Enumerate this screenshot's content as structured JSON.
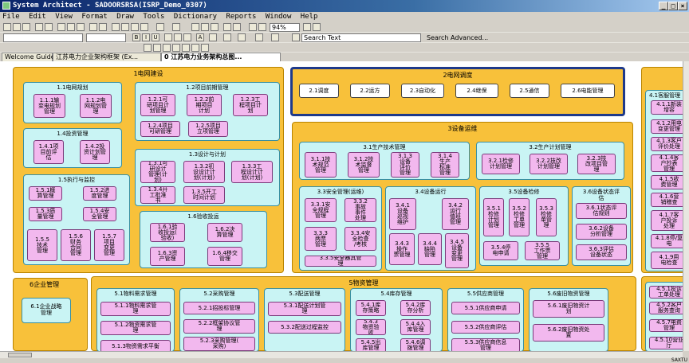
{
  "window": {
    "title": "System Architect - SADOORSRSA(ISRP_Demo_0307)",
    "min": "_",
    "max": "□",
    "close": "×"
  },
  "menu": [
    "File",
    "Edit",
    "View",
    "Format",
    "Draw",
    "Tools",
    "Dictionary",
    "Reports",
    "Window",
    "Help"
  ],
  "toolbar": {
    "zoom": "94%",
    "search_text": "Search Text",
    "search_advanced": "Search Advanced..."
  },
  "tabs": [
    "Welcome Guide",
    "江苏电力企业架构框架 (Ex...",
    "0 江苏电力业务架构总图..."
  ],
  "groups": {
    "g1": {
      "title": "1电网建设",
      "s11": {
        "title": "1.1电网规划",
        "items": [
          "1.1.1输\n变电规划\n管理",
          "1.1.2电\n网规划管\n理"
        ]
      },
      "s12": {
        "title": "1.2项目前期管理",
        "items": [
          "1.2.1可\n研项目计\n划管理",
          "1.2.2前\n期项目\n计划",
          "1.2.3工\n程项目计\n划",
          "1.2.4项目\n可研管理",
          "1.2.5项目\n立项管理"
        ]
      },
      "s14": {
        "title": "1.4投资管理",
        "items": [
          "1.4.1项\n目前评\n估",
          "1.4.2投\n资计划管\n理"
        ]
      },
      "s13": {
        "title": "1.3设计与计划",
        "items": [
          "1.3.1可\n研设计\n管理(计\n划)",
          "1.3.2初\n设设计计\n划(计划)",
          "1.3.3工\n程设计计\n划(计划)",
          "1.3.4开\n工批准\n书",
          "1.3.5开工\n时间计划"
        ]
      },
      "s15": {
        "title": "1.5执行与监控",
        "items": [
          "1.5.1概\n算管理",
          "1.5.2进\n度管理",
          "1.5.3质\n量管理",
          "1.5.4安\n全管理",
          "1.5.5\n技术\n管理",
          "1.5.6\n财务\n合同\n管理",
          "1.5.7\n项目\n变更\n管理"
        ]
      },
      "s16": {
        "title": "1.6验收投运",
        "items": [
          "1.6.1验\n收投运(\n验收)",
          "1.6.2决\n算管理",
          "1.6.3资\n产管理",
          "1.6.4移交\n管理"
        ]
      }
    },
    "g2": {
      "title": "2电网调度",
      "items": [
        "2.1调度",
        "2.2运方",
        "2.3自动化",
        "2.4继保",
        "2.5通信",
        "2.6电能管理"
      ]
    },
    "g3": {
      "title": "3设备运维",
      "s31": {
        "title": "3.1生产技术管理",
        "items": [
          "3.1.1技\n术规范\n管理",
          "3.1.2技\n术监督\n管理",
          "3.1.3\n设备\n评价\n管理",
          "3.1.4\n生产\n标准\n管理"
        ]
      },
      "s32": {
        "title": "3.2生产计划管理",
        "items": [
          "3.2.1检修\n计划管理",
          "3.2.2技改\n计划管理",
          "3.2.3技\n改项目管\n理"
        ]
      },
      "s33": {
        "title": "3.3安全管理(运维)",
        "items": [
          "3.3.1安\n全规程\n管理",
          "3.3.2\n事故\n事件\n处理",
          "3.3.3\n两票\n管理",
          "3.3.4安\n全检查\n/考核",
          "3.3.5安全器具管\n理"
        ]
      },
      "s34": {
        "title": "3.4设备运行",
        "items": [
          "3.4.1\n设备\n巡视\n维护",
          "3.4.2\n运行\n值班\n管理",
          "3.4.3\n操作\n票管理",
          "3.4.4\n缺陷\n管理",
          "3.4.5\n设备\n变更\n管理"
        ]
      },
      "s35": {
        "title": "3.5设备检修",
        "items": [
          "3.5.1\n检修\n计划\n管理",
          "3.5.2\n检修\n工单\n管理",
          "3.5.3\n检修\n单管\n理",
          "3.5.4停\n电申请",
          "3.5.5\n工作票\n管理"
        ]
      },
      "s36": {
        "title": "3.6设备状态评\n估",
        "items": [
          "3.6.1状态评\n估规则",
          "3.6.2设备\n分析管理",
          "3.6.3评估\n设备状态"
        ]
      }
    },
    "g4": {
      "title": "4.1客服管理",
      "items": [
        "4.1.1新装\n增容",
        "4.1.2用电\n变更管理",
        "4.1.3客户\n评价处理",
        "4.1.4客\n户抄表\n管理",
        "4.1.5收\n费管理",
        "4.1.6营\n销稽查",
        "4.1.7客\n户投诉\n处理",
        "4.1.8停/复\n电",
        "4.1.9用\n电检查"
      ]
    },
    "g6": {
      "title": "6企业管理",
      "items": [
        "6.1企业战略\n管理"
      ]
    },
    "g5": {
      "title": "5物资管理",
      "s51": {
        "title": "5.1物料需求管理",
        "items": [
          "5.1.1物料需求管\n理",
          "5.1.2物资需求管\n理",
          "5.1.3物资需求平衡"
        ]
      },
      "s52": {
        "title": "5.2采购管理",
        "items": [
          "5.2.1招投标管理",
          "5.2.2框架协议管\n理",
          "5.2.3采购管理(\n采购)"
        ]
      },
      "s53": {
        "title": "5.3配送管理",
        "items": [
          "5.3.1配送计划管\n理",
          "5.3.2配送过程监控"
        ]
      },
      "s54": {
        "title": "5.4库存管理",
        "items": [
          "5.4.1库\n存策略",
          "5.4.2库\n存分析",
          "5.4.3\n物资验\n收",
          "5.4.4入\n库管理",
          "5.4.5出\n库管理",
          "5.4.6调\n拨管理"
        ]
      },
      "s55": {
        "title": "5.5供应商管理",
        "items": [
          "5.5.1供应商申请",
          "5.5.2供应商评估",
          "5.5.3供应商信息\n管理"
        ]
      },
      "s56": {
        "title": "5.6废旧物资管理",
        "items": [
          "5.6.1废旧物资计\n划",
          "5.6.2废旧物资处\n置"
        ]
      }
    },
    "g45": {
      "items": [
        "4.5.1投诉\n工单处理",
        "4.5.2客户\n服务查询",
        "4.5.7电费\n管理",
        "4.5.10营业\n厅"
      ]
    }
  },
  "status": "SAXTU"
}
